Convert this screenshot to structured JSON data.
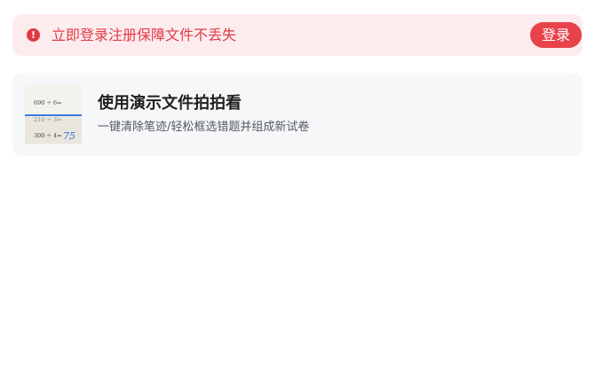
{
  "banner": {
    "message": "立即登录注册保障文件不丢失",
    "login_label": "登录",
    "icon": "exclamation-icon"
  },
  "demo_card": {
    "title": "使用演示文件拍拍看",
    "subtitle": "一键清除笔迹/轻松框选错题并组成新试卷",
    "thumbnail": {
      "icon": "worksheet-thumbnail",
      "lines": [
        "690 ÷ 6=",
        "210 ÷ 3=",
        "300 ÷ 4="
      ],
      "handwriting": "75"
    }
  },
  "colors": {
    "accent": "#e8424a",
    "banner_bg": "#fdecee",
    "card_bg": "#f6f7f9",
    "scan_line": "#3a78e0"
  }
}
